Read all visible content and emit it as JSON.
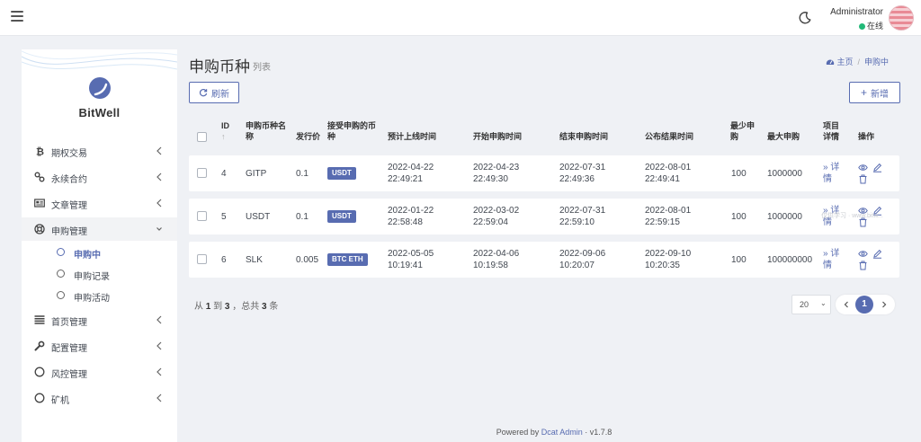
{
  "topbar": {
    "user_name": "Administrator",
    "user_status": "在线"
  },
  "brand": {
    "name": "BitWell"
  },
  "sidebar": {
    "items": [
      {
        "label": "期权交易",
        "icon": "bitcoin-icon"
      },
      {
        "label": "永续合约",
        "icon": "link-icon"
      },
      {
        "label": "文章管理",
        "icon": "newspaper-icon"
      },
      {
        "label": "申购管理",
        "icon": "lifebuoy-icon"
      },
      {
        "label": "首页管理",
        "icon": "list-icon"
      },
      {
        "label": "配置管理",
        "icon": "wrench-icon"
      },
      {
        "label": "风控管理",
        "icon": "circle-icon"
      },
      {
        "label": "矿机",
        "icon": "circle-icon"
      }
    ],
    "sub_items": [
      {
        "label": "申购中"
      },
      {
        "label": "申购记录"
      },
      {
        "label": "申购活动"
      }
    ]
  },
  "header": {
    "title": "申购币种",
    "subtitle": "列表",
    "breadcrumb": [
      "主页",
      "申购中"
    ]
  },
  "toolbar": {
    "refresh_label": "刷新",
    "add_label": "新增"
  },
  "table": {
    "columns": {
      "id": "ID",
      "name": "申购币种名称",
      "price": "发行价",
      "accepted": "接受申购的币种",
      "listing": "预计上线时间",
      "start": "开始申购时间",
      "end": "结束申购时间",
      "result": "公布结果时间",
      "min": "最少申购",
      "max": "最大申购",
      "detail": "项目详情",
      "actions": "操作"
    },
    "detail_link": "详情",
    "rows": [
      {
        "id": "4",
        "name": "GITP",
        "price": "0.1",
        "accepted": "USDT",
        "listing_date": "2022-04-22",
        "listing_time": "22:49:21",
        "start_date": "2022-04-23",
        "start_time": "22:49:30",
        "end_date": "2022-07-31",
        "end_time": "22:49:36",
        "result_date": "2022-08-01",
        "result_time": "22:49:41",
        "min": "100",
        "max": "1000000"
      },
      {
        "id": "5",
        "name": "USDT",
        "price": "0.1",
        "accepted": "USDT",
        "listing_date": "2022-01-22",
        "listing_time": "22:58:48",
        "start_date": "2022-03-02",
        "start_time": "22:59:04",
        "end_date": "2022-07-31",
        "end_time": "22:59:10",
        "result_date": "2022-08-01",
        "result_time": "22:59:15",
        "min": "100",
        "max": "1000000"
      },
      {
        "id": "6",
        "name": "SLK",
        "price": "0.005",
        "accepted": "BTC ETH",
        "listing_date": "2022-05-05",
        "listing_time": "10:19:41",
        "start_date": "2022-04-06",
        "start_time": "10:19:58",
        "end_date": "2022-09-06",
        "end_time": "10:20:07",
        "result_date": "2022-09-10",
        "result_time": "10:20:35",
        "min": "100",
        "max": "100000000"
      }
    ]
  },
  "watermark": "仅供学习 · www.bitw...",
  "pagination": {
    "summary_prefix": "从",
    "from": "1",
    "to_word": "到",
    "to": "3",
    "total_prefix": "，总共",
    "total": "3",
    "total_suffix": "条",
    "per_page": "20",
    "current_page": "1"
  },
  "footer": {
    "powered_prefix": "Powered by",
    "powered_link": "Dcat Admin",
    "version": "· v1.7.8"
  },
  "colors": {
    "accent": "#586cb1",
    "online": "#21b978",
    "background": "#eff1f5"
  }
}
